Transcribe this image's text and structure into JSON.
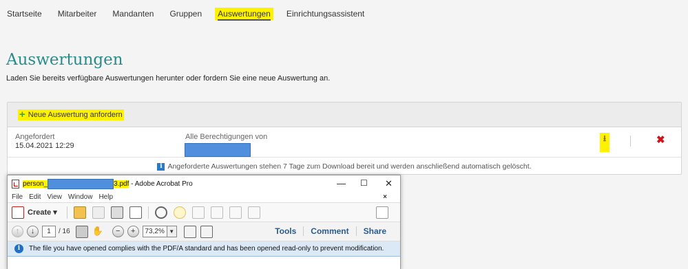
{
  "nav": {
    "items": [
      "Startseite",
      "Mitarbeiter",
      "Mandanten",
      "Gruppen",
      "Auswertungen",
      "Einrichtungsassistent"
    ]
  },
  "page": {
    "title": "Auswertungen",
    "subtitle": "Laden Sie bereits verfügbare Auswertungen herunter oder fordern Sie eine neue Auswertung an."
  },
  "panel": {
    "new_request_label": "Neue Auswertung anfordern",
    "row": {
      "requested_label": "Angefordert",
      "requested_value": "15.04.2021 12:29",
      "permissions_label": "Alle Berechtigungen von"
    },
    "info_text": "Angeforderte Auswertungen stehen 7 Tage zum Download bereit und werden anschließend automatisch gelöscht."
  },
  "acrobat": {
    "title_prefix": "person_",
    "title_suffix": "3.pdf",
    "title_app": " - Adobe Acrobat Pro",
    "menu": [
      "File",
      "Edit",
      "View",
      "Window",
      "Help"
    ],
    "create_label": "Create",
    "page_current": "1",
    "page_total": "/ 16",
    "zoom": "73,2%",
    "links": [
      "Tools",
      "Comment",
      "Share"
    ],
    "notice": "The file you have opened complies with the PDF/A standard and has been opened read-only to prevent modification."
  }
}
